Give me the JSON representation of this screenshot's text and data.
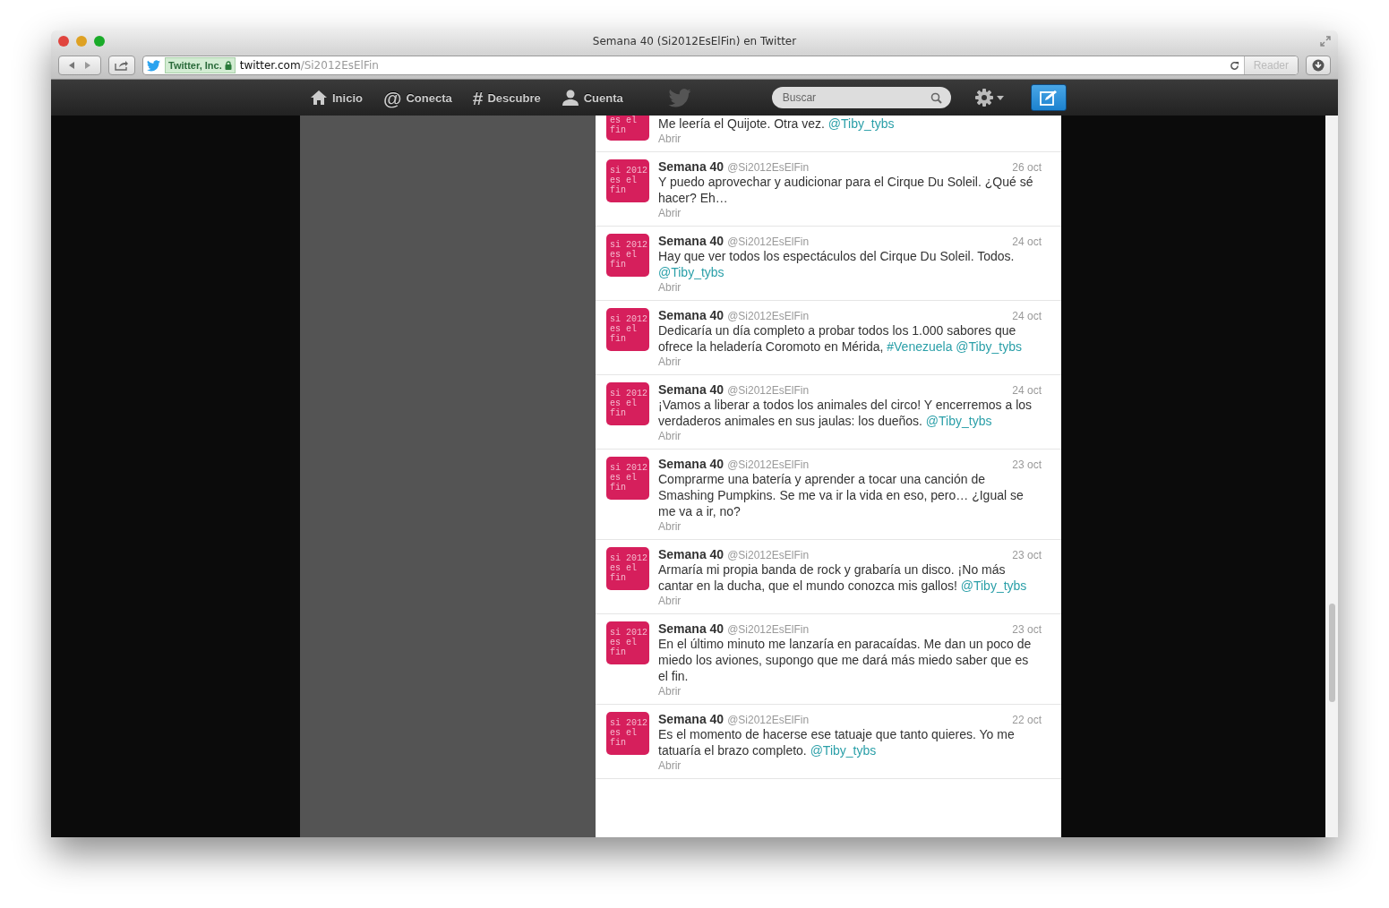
{
  "window": {
    "title": "Semana 40 (Si2012EsElFin) en Twitter"
  },
  "address_bar": {
    "identity": "Twitter, Inc.",
    "domain": "twitter.com",
    "path": "/Si2012EsElFin",
    "reader": "Reader"
  },
  "nav": {
    "items": [
      {
        "kind": "home",
        "label": "Inicio"
      },
      {
        "kind": "glyph",
        "glyph": "@",
        "label": "Conecta"
      },
      {
        "kind": "glyph",
        "glyph": "#",
        "label": "Descubre"
      },
      {
        "kind": "person",
        "label": "Cuenta"
      }
    ],
    "search": {
      "placeholder": "Buscar"
    }
  },
  "tweets": [
    {
      "kind": "partial",
      "avatar_lines": [
        "es el",
        "fin"
      ],
      "text": [
        {
          "kind": "plain",
          "text": "Me leería el Quijote. Otra vez. "
        },
        {
          "kind": "link",
          "text": "@Tiby_tybs"
        }
      ],
      "open": "Abrir"
    },
    {
      "kind": "full",
      "avatar_lines": [
        "si 2012",
        "es el",
        "fin"
      ],
      "name": "Semana 40",
      "handle": "@Si2012EsElFin",
      "date": "26 oct",
      "text": [
        {
          "kind": "plain",
          "text": "Y puedo aprovechar y audicionar para el Cirque Du Soleil. ¿Qué sé hacer? Eh…"
        }
      ],
      "open": "Abrir"
    },
    {
      "kind": "full",
      "avatar_lines": [
        "si 2012",
        "es el",
        "fin"
      ],
      "name": "Semana 40",
      "handle": "@Si2012EsElFin",
      "date": "24 oct",
      "text": [
        {
          "kind": "plain",
          "text": "Hay que ver todos los espectáculos del Cirque Du Soleil. Todos. "
        },
        {
          "kind": "link",
          "text": "@Tiby_tybs"
        }
      ],
      "open": "Abrir"
    },
    {
      "kind": "full",
      "avatar_lines": [
        "si 2012",
        "es el",
        "fin"
      ],
      "name": "Semana 40",
      "handle": "@Si2012EsElFin",
      "date": "24 oct",
      "text": [
        {
          "kind": "plain",
          "text": "Dedicaría un día completo a probar todos los 1.000 sabores que ofrece la heladería Coromoto en Mérida, "
        },
        {
          "kind": "link",
          "text": "#Venezuela"
        },
        {
          "kind": "link",
          "text": "@Tiby_tybs"
        }
      ],
      "open": "Abrir"
    },
    {
      "kind": "full",
      "avatar_lines": [
        "si 2012",
        "es el",
        "fin"
      ],
      "name": "Semana 40",
      "handle": "@Si2012EsElFin",
      "date": "24 oct",
      "text": [
        {
          "kind": "plain",
          "text": "¡Vamos a liberar a todos los animales del circo! Y encerremos a los verdaderos animales en sus jaulas: los dueños. "
        },
        {
          "kind": "link",
          "text": "@Tiby_tybs"
        }
      ],
      "open": "Abrir"
    },
    {
      "kind": "full",
      "avatar_lines": [
        "si 2012",
        "es el",
        "fin"
      ],
      "name": "Semana 40",
      "handle": "@Si2012EsElFin",
      "date": "23 oct",
      "text": [
        {
          "kind": "plain",
          "text": "Comprarme una batería y aprender a tocar una canción de Smashing Pumpkins. Se me va ir la vida en eso, pero… ¿Igual se me va a ir, no?"
        }
      ],
      "open": "Abrir"
    },
    {
      "kind": "full",
      "avatar_lines": [
        "si 2012",
        "es el",
        "fin"
      ],
      "name": "Semana 40",
      "handle": "@Si2012EsElFin",
      "date": "23 oct",
      "text": [
        {
          "kind": "plain",
          "text": "Armaría mi propia banda de rock y grabaría un disco. ¡No más cantar en la ducha, que el mundo conozca mis gallos! "
        },
        {
          "kind": "link",
          "text": "@Tiby_tybs"
        }
      ],
      "open": "Abrir"
    },
    {
      "kind": "full",
      "avatar_lines": [
        "si 2012",
        "es el",
        "fin"
      ],
      "name": "Semana 40",
      "handle": "@Si2012EsElFin",
      "date": "23 oct",
      "text": [
        {
          "kind": "plain",
          "text": "En el último minuto me lanzaría en paracaídas. Me dan un poco de miedo los aviones, supongo que me dará más miedo saber que es el fin."
        }
      ],
      "open": "Abrir"
    },
    {
      "kind": "full",
      "avatar_lines": [
        "si 2012",
        "es el",
        "fin"
      ],
      "name": "Semana 40",
      "handle": "@Si2012EsElFin",
      "date": "22 oct",
      "text": [
        {
          "kind": "plain",
          "text": "Es el momento de hacerse ese tatuaje que tanto quieres. Yo me tatuaría el brazo completo. "
        },
        {
          "kind": "link",
          "text": "@Tiby_tybs"
        }
      ],
      "open": "Abrir"
    }
  ]
}
